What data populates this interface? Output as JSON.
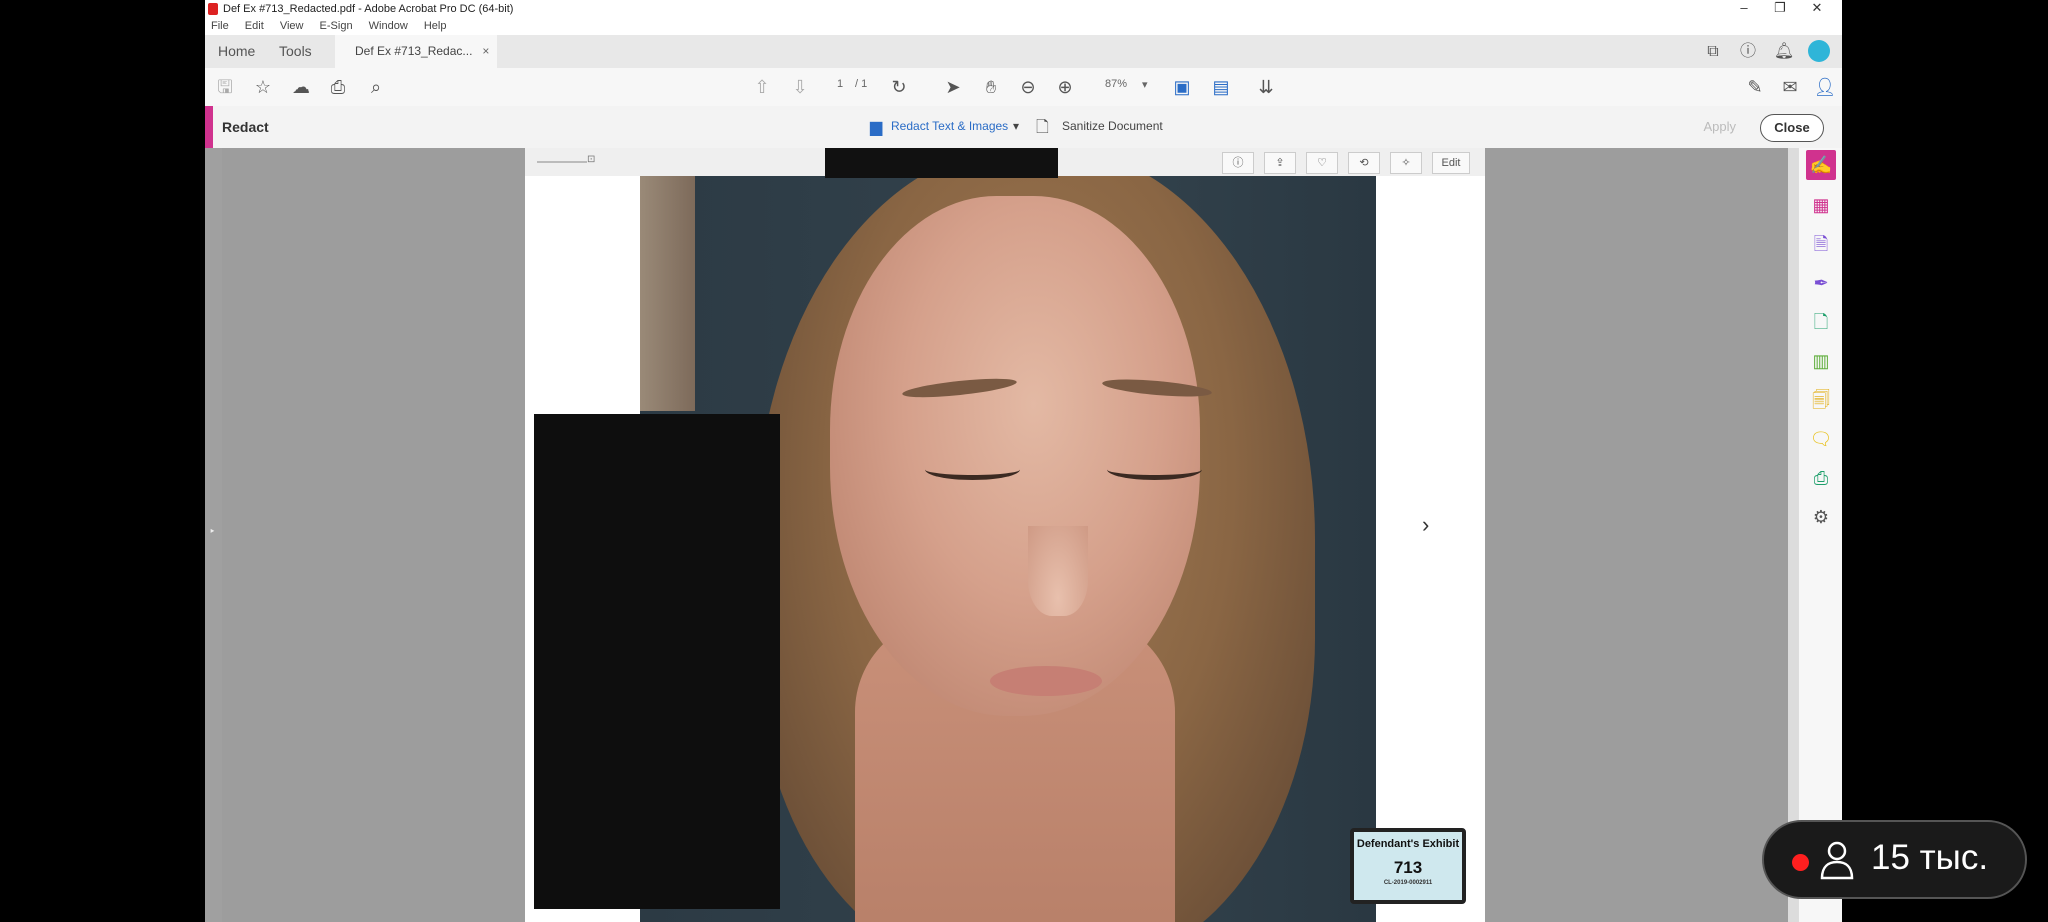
{
  "window": {
    "title": "Def Ex  #713_Redacted.pdf - Adobe Acrobat Pro DC (64-bit)",
    "controls": {
      "minimize": "–",
      "maximize": "❐",
      "close": "✕"
    }
  },
  "menu": [
    "File",
    "Edit",
    "View",
    "E-Sign",
    "Window",
    "Help"
  ],
  "tabs": {
    "home": "Home",
    "tools": "Tools",
    "document": "Def Ex  #713_Redac...",
    "close": "×"
  },
  "toolbar": {
    "page_current": "1",
    "page_total": "/ 1",
    "zoom": "87%",
    "zoom_caret": "▾"
  },
  "redact_bar": {
    "label": "Redact",
    "redact_tool": "Redact Text & Images",
    "redact_caret": "▾",
    "sanitize": "Sanitize Document",
    "apply": "Apply",
    "close": "Close"
  },
  "page_toolbar": {
    "slider_value": "⊡",
    "edit": "Edit"
  },
  "exhibit_stamp": {
    "title": "Defendant's Exhibit",
    "number": "713",
    "case_id": "CL-2019-0002911"
  },
  "nav": {
    "next": "›",
    "sidebar_toggle": "‣"
  },
  "live": {
    "viewers": "15 тыс."
  }
}
